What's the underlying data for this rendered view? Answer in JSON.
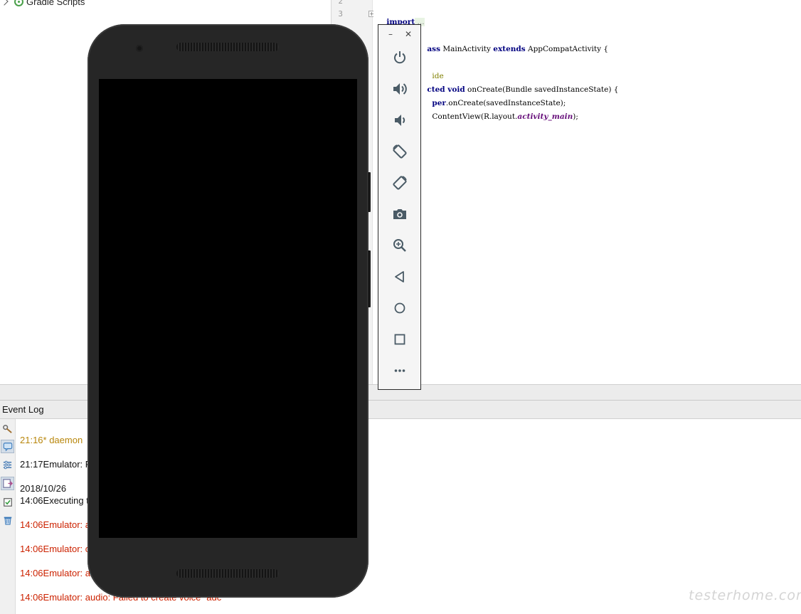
{
  "project_tree": {
    "gradle_scripts_label": "Gradle Scripts"
  },
  "editor": {
    "line_numbers": [
      "2",
      "3"
    ],
    "code": {
      "l3_kw": "import",
      "l3_fold": " ...",
      "l5_kw": "ass",
      "l5_rest": " MainActivity ",
      "l5_kw2": "extends",
      "l5_rest2": " AppCompatActivity {",
      "l7_ann": "ide",
      "l8_kw": "cted void",
      "l8_rest": " onCreate(Bundle savedInstanceState) {",
      "l9_kw": "per",
      "l9_rest": ".onCreate(savedInstanceState);",
      "l10_rest": "ContentView(R.layout.",
      "l10_fld": "activity_main",
      "l10_end": ");"
    }
  },
  "event_log": {
    "title": "Event Log",
    "lines": [
      {
        "text": "21:16* daemon",
        "color": "orange"
      },
      {
        "text": "21:17Emulator: F",
        "color": "black"
      },
      {
        "text": "2018/10/26",
        "color": "black"
      },
      {
        "text": "14:06Executing t",
        "color": "black"
      },
      {
        "text": "14:06Emulator: a",
        "color": "red"
      },
      {
        "text": "14:06Emulator: c",
        "color": "red"
      },
      {
        "text": "14:06Emulator: a",
        "color": "red"
      },
      {
        "text": "14:06Emulator: audio: Failed to create voice `adc'",
        "color": "red"
      }
    ],
    "toolbar_icons": [
      "settings-icon",
      "soft-wrap-icon",
      "filter-icon",
      "scroll-to-end-icon",
      "mark-read-icon",
      "clear-icon"
    ]
  },
  "emulator": {
    "minimize_label": "–",
    "close_label": "✕",
    "buttons": [
      "power-icon",
      "volume-up-icon",
      "volume-down-icon",
      "rotate-left-icon",
      "rotate-right-icon",
      "camera-icon",
      "zoom-icon",
      "back-icon",
      "home-icon",
      "overview-icon",
      "more-icon"
    ]
  },
  "watermark": "testerhome.com",
  "colors": {
    "log_orange": "#b8860b",
    "log_red": "#cc2200",
    "keyword_blue": "#000080",
    "annotation_olive": "#808000",
    "field_purple": "#660e7a",
    "emulator_icon": "#4a5b66"
  }
}
